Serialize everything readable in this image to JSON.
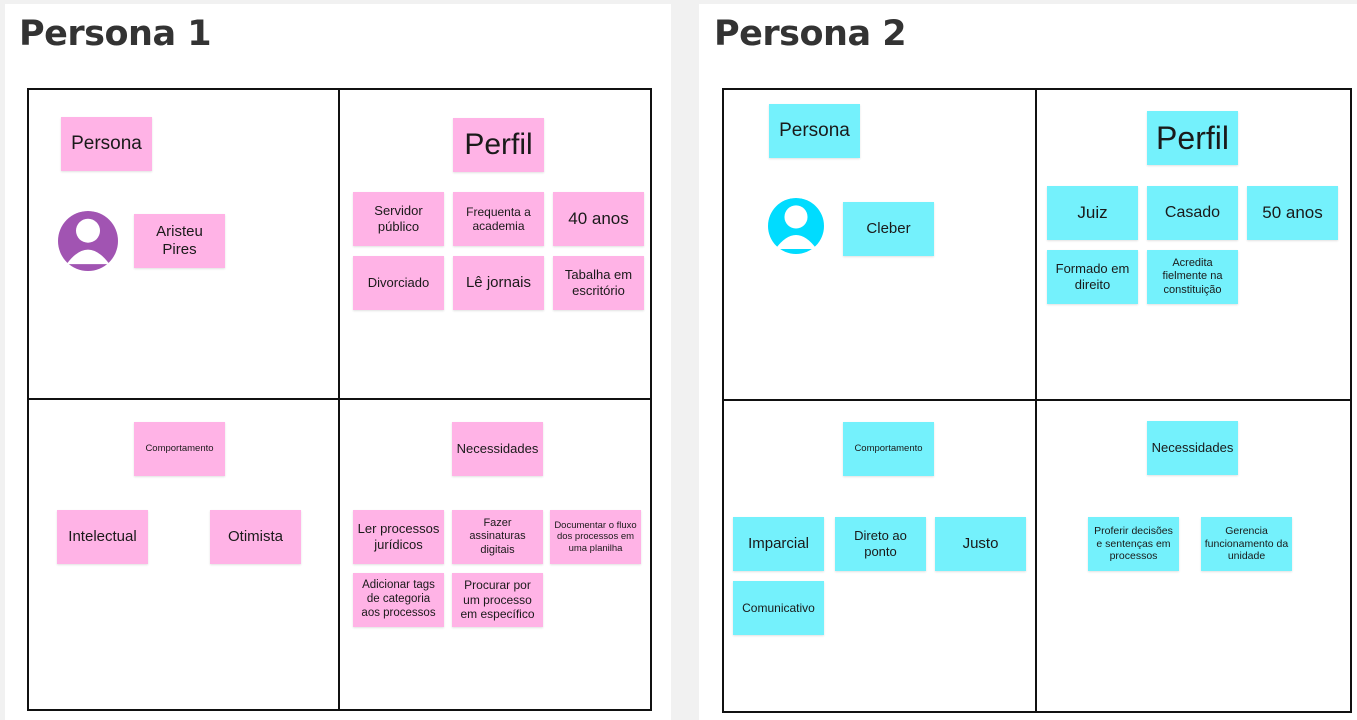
{
  "colors": {
    "pink_sticky": "#ffb3e6",
    "cyan_sticky": "#74f1fc",
    "avatar1": "#a154b2",
    "avatar2": "#00dcff"
  },
  "persona1": {
    "title": "Persona 1",
    "persona_label": "Persona",
    "name": "Aristeu Pires",
    "avatar_icon": "user-avatar-icon",
    "perfil": {
      "title": "Perfil",
      "items": [
        "Servidor público",
        "Frequenta a academia",
        "40 anos",
        "Divorciado",
        "Lê jornais",
        "Tabalha em escritório"
      ]
    },
    "comportamento": {
      "title": "Comportamento",
      "items": [
        "Intelectual",
        "Otimista"
      ]
    },
    "necessidades": {
      "title": "Necessidades",
      "items": [
        "Ler processos jurídicos",
        "Fazer assinaturas digitais",
        "Documentar o fluxo dos processos em uma planilha",
        "Adicionar tags de categoria aos processos",
        "Procurar por um processo em específico"
      ]
    }
  },
  "persona2": {
    "title": "Persona 2",
    "persona_label": "Persona",
    "name": "Cleber",
    "avatar_icon": "user-avatar-icon",
    "perfil": {
      "title": "Perfil",
      "items": [
        "Juiz",
        "Casado",
        "50 anos",
        "Formado em direito",
        "Acredita fielmente na constituição"
      ]
    },
    "comportamento": {
      "title": "Comportamento",
      "items": [
        "Imparcial",
        "Direto ao ponto",
        "Justo",
        "Comunicativo"
      ]
    },
    "necessidades": {
      "title": "Necessidades",
      "items": [
        "Proferir decisões e sentenças em processos",
        "Gerencia funcionamento da unidade"
      ]
    }
  }
}
